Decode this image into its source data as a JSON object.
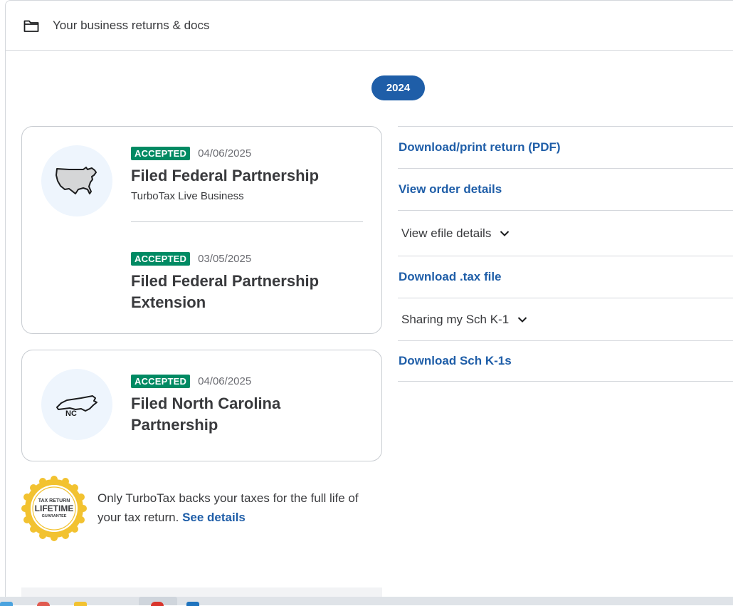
{
  "header": {
    "title": "Your business returns & docs",
    "icon": "folder-icon"
  },
  "year": "2024",
  "federal_card": {
    "map_icon": "usa-map-icon",
    "filings": [
      {
        "status": "ACCEPTED",
        "date": "04/06/2025",
        "title": "Filed Federal Partnership",
        "subtitle": "TurboTax Live Business"
      },
      {
        "status": "ACCEPTED",
        "date": "03/05/2025",
        "title": "Filed Federal Partnership Extension"
      }
    ]
  },
  "nc_card": {
    "map_icon": "north-carolina-map-icon",
    "map_label": "NC",
    "filings": [
      {
        "status": "ACCEPTED",
        "date": "04/06/2025",
        "title": "Filed North Carolina Partnership"
      }
    ]
  },
  "links": [
    {
      "label": "Download/print return (PDF)",
      "style": "link"
    },
    {
      "label": "View order details",
      "style": "link"
    },
    {
      "label": "View efile details",
      "style": "dropdown"
    },
    {
      "label": "Download .tax file",
      "style": "link"
    },
    {
      "label": "Sharing my Sch K-1",
      "style": "dropdown"
    },
    {
      "label": "Download Sch K-1s",
      "style": "link"
    }
  ],
  "guarantee": {
    "seal_line1": "TAX RETURN",
    "seal_line2": "LIFETIME",
    "seal_line3": "GUARANTEE",
    "text": "Only TurboTax backs your taxes for the full life of your tax return.",
    "link": "See details"
  },
  "colors": {
    "accent_blue": "#1f5ea8",
    "accepted_green": "#008a63",
    "seal_gold": "#f2c230",
    "map_bg": "#eef5fd"
  }
}
